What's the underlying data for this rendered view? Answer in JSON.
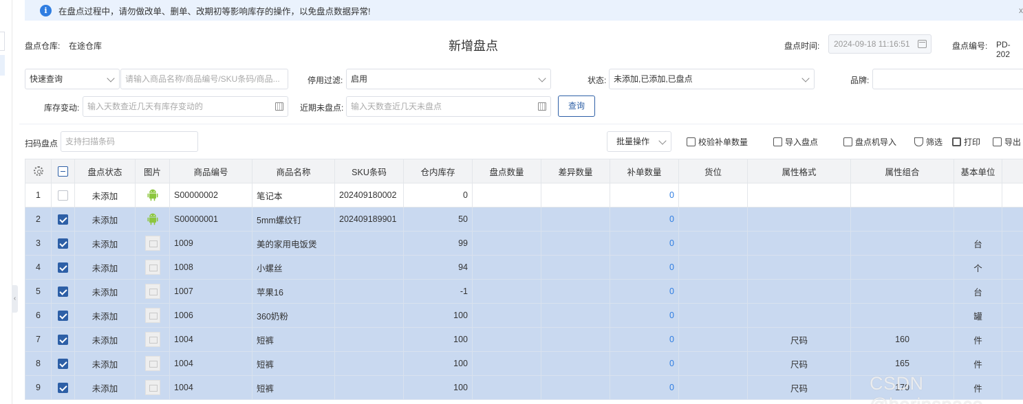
{
  "alert": {
    "message": "在盘点过程中，请勿做改单、删单、改期初等影响库存的操作，以免盘点数据异常!",
    "close": "x"
  },
  "header": {
    "warehouse_label": "盘点仓库:",
    "warehouse_value": "在途仓库",
    "title": "新增盘点",
    "time_label": "盘点时间:",
    "time_value": "2024-09-18 11:16:51",
    "code_label": "盘点编号:",
    "code_value": "PD-202"
  },
  "filters": {
    "quick_query": "快速查询",
    "search_placeholder": "请输入商品名称/商品编号/SKU条码/商品...",
    "disable_filter_label": "停用过滤:",
    "disable_filter_value": "启用",
    "status_label": "状态:",
    "status_value": "未添加,已添加,已盘点",
    "brand_label": "品牌:",
    "stock_change_label": "库存变动:",
    "stock_change_placeholder": "输入天数查近几天有库存变动的",
    "recent_uncounted_label": "近期未盘点:",
    "recent_uncounted_placeholder": "输入天数查近几天未盘点",
    "query_button": "查询"
  },
  "toolbar": {
    "scan_label": "扫码盘点",
    "scan_placeholder": "支持扫描条码",
    "batch": "批量操作",
    "verify": "校验补单数量",
    "import": "导入盘点",
    "device_import": "盘点机导入",
    "filter": "筛选",
    "print": "打印",
    "export": "导出"
  },
  "table": {
    "columns": [
      "",
      "",
      "盘点状态",
      "图片",
      "商品编号",
      "商品名称",
      "SKU条码",
      "仓内库存",
      "盘点数量",
      "差异数量",
      "补单数量",
      "货位",
      "属性格式",
      "属性组合",
      "基本单位"
    ],
    "rows": [
      {
        "no": "1",
        "checked": false,
        "status": "未添加",
        "img": "android",
        "code": "S00000002",
        "name": "笔记本",
        "sku": "202409180002",
        "stock": "0",
        "count": "",
        "diff": "",
        "supp": "0",
        "loc": "",
        "attr_fmt": "",
        "attr_combo": "",
        "unit": ""
      },
      {
        "no": "2",
        "checked": true,
        "status": "未添加",
        "img": "android",
        "code": "S00000001",
        "name": "5mm螺纹钉",
        "sku": "202409189901",
        "stock": "50",
        "count": "",
        "diff": "",
        "supp": "0",
        "loc": "",
        "attr_fmt": "",
        "attr_combo": "",
        "unit": ""
      },
      {
        "no": "3",
        "checked": true,
        "status": "未添加",
        "img": "placeholder",
        "code": "1009",
        "name": "美的家用电饭煲",
        "sku": "",
        "stock": "99",
        "count": "",
        "diff": "",
        "supp": "0",
        "loc": "",
        "attr_fmt": "",
        "attr_combo": "",
        "unit": "台"
      },
      {
        "no": "4",
        "checked": true,
        "status": "未添加",
        "img": "placeholder",
        "code": "1008",
        "name": "小螺丝",
        "sku": "",
        "stock": "94",
        "count": "",
        "diff": "",
        "supp": "0",
        "loc": "",
        "attr_fmt": "",
        "attr_combo": "",
        "unit": "个"
      },
      {
        "no": "5",
        "checked": true,
        "status": "未添加",
        "img": "placeholder",
        "code": "1007",
        "name": "苹果16",
        "sku": "",
        "stock": "-1",
        "count": "",
        "diff": "",
        "supp": "0",
        "loc": "",
        "attr_fmt": "",
        "attr_combo": "",
        "unit": "台"
      },
      {
        "no": "6",
        "checked": true,
        "status": "未添加",
        "img": "placeholder",
        "code": "1006",
        "name": "360奶粉",
        "sku": "",
        "stock": "100",
        "count": "",
        "diff": "",
        "supp": "0",
        "loc": "",
        "attr_fmt": "",
        "attr_combo": "",
        "unit": "罐"
      },
      {
        "no": "7",
        "checked": true,
        "status": "未添加",
        "img": "placeholder",
        "code": "1004",
        "name": "短裤",
        "sku": "",
        "stock": "100",
        "count": "",
        "diff": "",
        "supp": "0",
        "loc": "",
        "attr_fmt": "尺码",
        "attr_combo": "160",
        "unit": "件"
      },
      {
        "no": "8",
        "checked": true,
        "status": "未添加",
        "img": "placeholder",
        "code": "1004",
        "name": "短裤",
        "sku": "",
        "stock": "100",
        "count": "",
        "diff": "",
        "supp": "0",
        "loc": "",
        "attr_fmt": "尺码",
        "attr_combo": "165",
        "unit": "件"
      },
      {
        "no": "9",
        "checked": true,
        "status": "未添加",
        "img": "placeholder",
        "code": "1004",
        "name": "短裤",
        "sku": "",
        "stock": "100",
        "count": "",
        "diff": "",
        "supp": "0",
        "loc": "",
        "attr_fmt": "尺码",
        "attr_combo": "170",
        "unit": "件"
      }
    ]
  },
  "watermark": "CSDN @herinspace",
  "colors": {
    "accent": "#2d5fa6",
    "selected_row": "#c9d9f0",
    "link_blue": "#2f7de1"
  }
}
